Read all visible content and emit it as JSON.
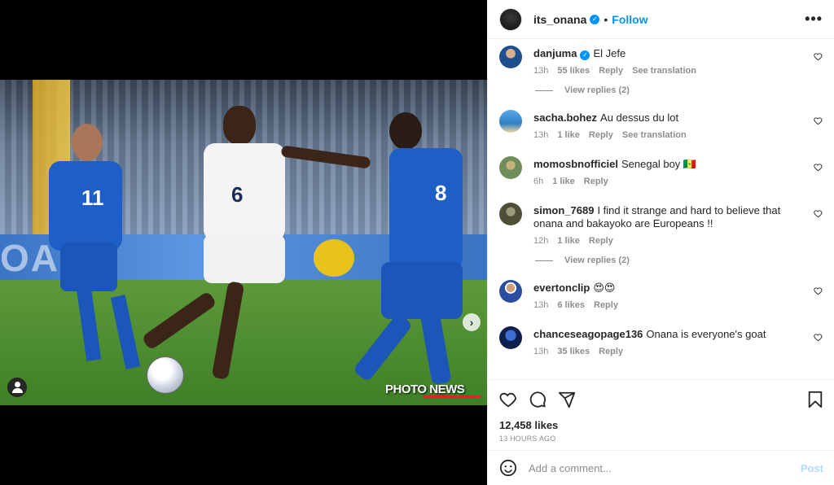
{
  "post": {
    "author": "its_onana",
    "follow_label": "Follow",
    "separator": "•",
    "more_label": "•••",
    "likes": "12,458 likes",
    "time": "13 HOURS AGO",
    "image_watermark": "PHOTO NEWS",
    "board_text": "OAIR",
    "carousel": {
      "total": 4,
      "active": 1
    }
  },
  "comments": [
    {
      "user": "danjuma",
      "verified": true,
      "text": "El Jefe",
      "time": "13h",
      "likes": "55 likes",
      "reply": "Reply",
      "translate": "See translation",
      "replies": "View replies (2)",
      "avatar_color": "#1e4f8f"
    },
    {
      "user": "sacha.bohez",
      "verified": false,
      "text": "Au dessus du lot",
      "time": "13h",
      "likes": "1 like",
      "reply": "Reply",
      "translate": "See translation",
      "replies": "",
      "avatar_color": "#3e8fd6"
    },
    {
      "user": "momosbnofficiel",
      "verified": false,
      "text": "Senegal boy 🇸🇳",
      "time": "6h",
      "likes": "1 like",
      "reply": "Reply",
      "translate": "",
      "replies": "",
      "avatar_color": "#6f8c5a"
    },
    {
      "user": "simon_7689",
      "verified": false,
      "text": "I find it strange and hard to believe that onana and bakayoko are Europeans !!",
      "time": "12h",
      "likes": "1 like",
      "reply": "Reply",
      "translate": "",
      "replies": "View replies (2)",
      "avatar_color": "#6a6a4c"
    },
    {
      "user": "evertonclip",
      "verified": false,
      "text": "😍😍",
      "time": "13h",
      "likes": "6 likes",
      "reply": "Reply",
      "translate": "",
      "replies": "",
      "avatar_color": "#2a4fa0"
    },
    {
      "user": "chanceseagopage136",
      "verified": false,
      "text": "Onana is everyone's goat",
      "time": "13h",
      "likes": "35 likes",
      "reply": "Reply",
      "translate": "",
      "replies": "",
      "avatar_color": "#1b3b80"
    }
  ],
  "add_comment": {
    "placeholder": "Add a comment...",
    "post_label": "Post"
  },
  "icons": {
    "like": "heart-icon",
    "comment": "comment-icon",
    "share": "share-icon",
    "save": "bookmark-icon",
    "emoji": "emoji-icon",
    "more": "more-icon",
    "verified": "verified-badge-icon",
    "tag": "user-tag-icon",
    "next": "chevron-right-icon"
  },
  "colors": {
    "accent": "#0095f6",
    "muted": "#8e8e8e",
    "text": "#262626",
    "post_disabled": "#b3dbff"
  }
}
